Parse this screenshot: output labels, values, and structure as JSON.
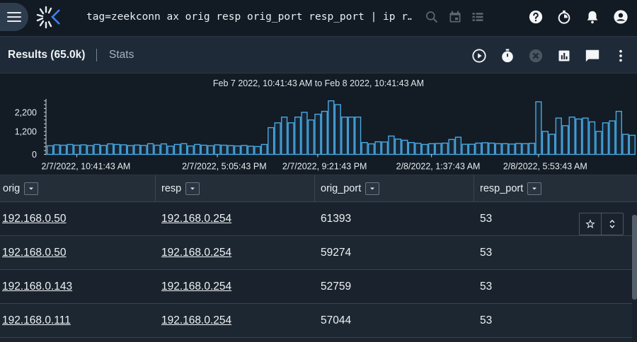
{
  "topbar": {
    "query": "tag=zeekconn ax orig resp orig_port resp_port | ip r…",
    "icons": [
      "menu-icon",
      "gravwell-logo",
      "search-icon",
      "calendar-icon",
      "list-icon",
      "help-icon",
      "timer-icon",
      "notifications-icon",
      "account-icon"
    ]
  },
  "results": {
    "title": "Results (65.0k)",
    "stats_label": "Stats",
    "icons": [
      "play-icon",
      "stopwatch-icon",
      "cancel-icon",
      "chart-icon",
      "comment-icon",
      "more-vert-icon"
    ]
  },
  "chart_data": {
    "type": "bar",
    "title": "Feb 7 2022, 10:41:43 AM to Feb 8 2022, 10:41:43 AM",
    "y_ticks": [
      "2,200",
      "1,200",
      "0"
    ],
    "y_tick_values": [
      2200,
      1200,
      0
    ],
    "ylim": [
      0,
      2900
    ],
    "x_ticks": [
      "2/7/2022, 10:41:43 AM",
      "2/7/2022, 5:05:43 PM",
      "2/7/2022, 9:21:43 PM",
      "2/8/2022, 1:37:43 AM",
      "2/8/2022, 5:53:43 AM"
    ],
    "x_tick_bar_index": [
      4,
      25,
      40,
      57,
      73
    ],
    "bar_color": "#47a9e4",
    "values": [
      450,
      500,
      480,
      520,
      480,
      500,
      460,
      520,
      470,
      550,
      520,
      500,
      460,
      490,
      470,
      560,
      480,
      550,
      430,
      520,
      560,
      440,
      520,
      480,
      450,
      500,
      480,
      460,
      440,
      470,
      430,
      410,
      520,
      1400,
      1650,
      1950,
      1650,
      1950,
      2200,
      1800,
      2100,
      2250,
      2800,
      2600,
      1950,
      1950,
      1950,
      620,
      550,
      660,
      650,
      960,
      800,
      740,
      620,
      580,
      520,
      560,
      570,
      590,
      780,
      900,
      530,
      530,
      590,
      610,
      590,
      560,
      560,
      540,
      570,
      560,
      580,
      2750,
      1200,
      1050,
      1900,
      1500,
      1950,
      1850,
      1900,
      1700,
      1200,
      1650,
      1750,
      2250,
      1050,
      1000
    ],
    "xlabel": "",
    "ylabel": ""
  },
  "table": {
    "columns": [
      "orig",
      "resp",
      "orig_port",
      "resp_port"
    ],
    "rows": [
      {
        "orig": "192.168.0.50",
        "resp": "192.168.0.254",
        "orig_port": "61393",
        "resp_port": "53"
      },
      {
        "orig": "192.168.0.50",
        "resp": "192.168.0.254",
        "orig_port": "59274",
        "resp_port": "53"
      },
      {
        "orig": "192.168.0.143",
        "resp": "192.168.0.254",
        "orig_port": "52759",
        "resp_port": "53"
      },
      {
        "orig": "192.168.0.111",
        "resp": "192.168.0.254",
        "orig_port": "57044",
        "resp_port": "53"
      }
    ]
  },
  "colors": {
    "accent_blue": "#47a9e4",
    "topbar_bg": "#121a23",
    "panel_bg": "#1e2a37"
  }
}
